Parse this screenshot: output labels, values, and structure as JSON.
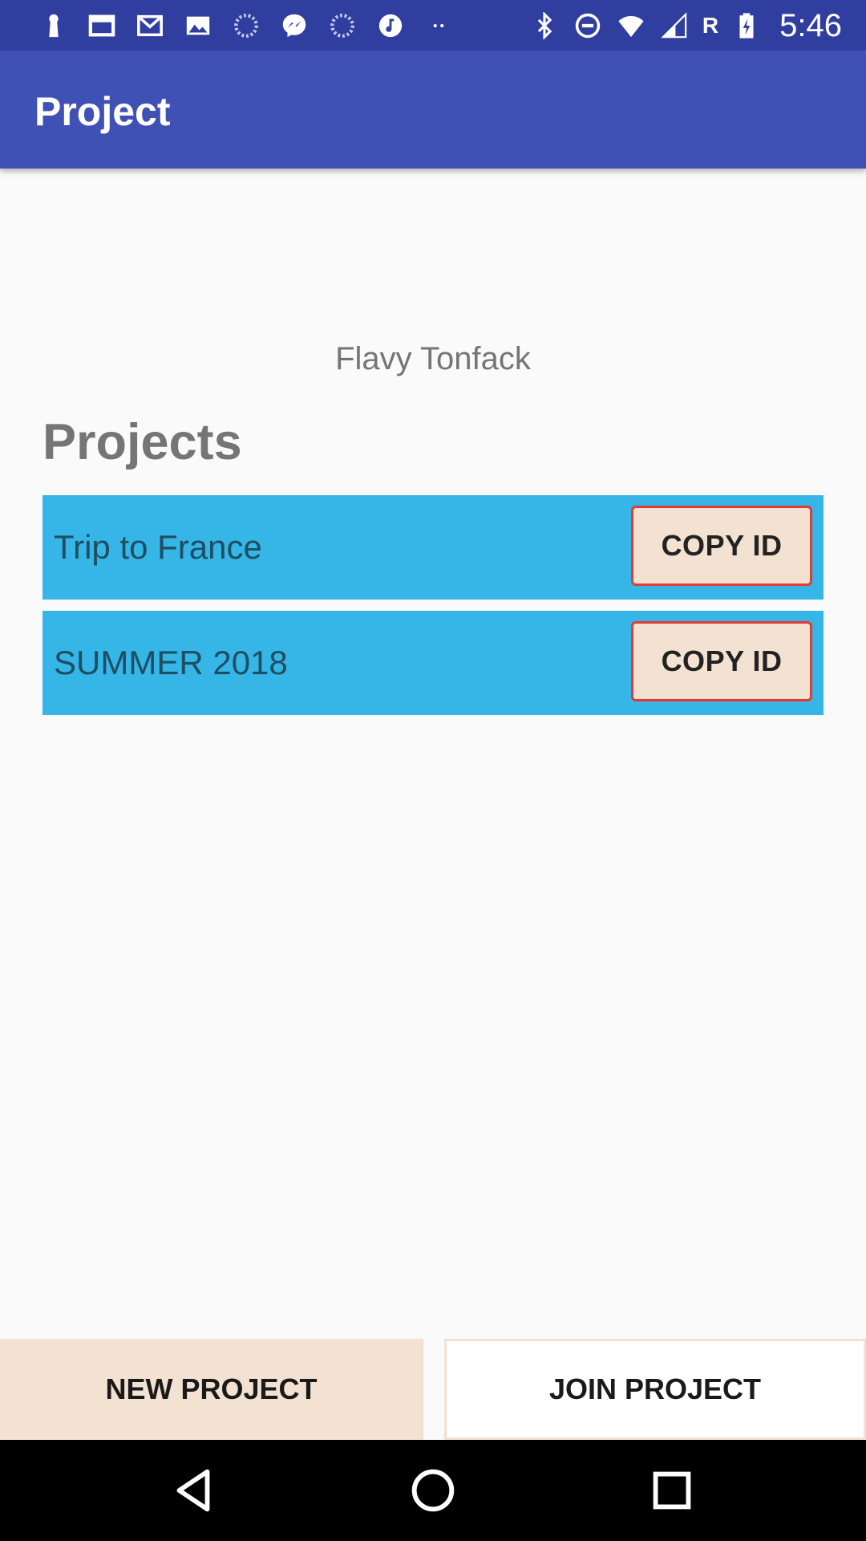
{
  "status_bar": {
    "time": "5:46",
    "carrier_indicator": "R",
    "icons_left": [
      "keyhole-icon",
      "window-icon",
      "gmail-icon",
      "image-icon",
      "loading-icon",
      "messenger-icon",
      "loading-icon",
      "music-icon",
      "more-dots-icon"
    ],
    "icons_right": [
      "bluetooth-icon",
      "do-not-disturb-icon",
      "wifi-icon",
      "signal-icon",
      "battery-charging-icon"
    ]
  },
  "app_bar": {
    "title": "Project"
  },
  "user": {
    "name": "Flavy Tonfack"
  },
  "projects": {
    "heading": "Projects",
    "items": [
      {
        "name": "Trip to France",
        "button_label": "COPY ID"
      },
      {
        "name": "SUMMER 2018",
        "button_label": "COPY ID"
      }
    ]
  },
  "actions": {
    "new_project_label": "NEW PROJECT",
    "join_project_label": "JOIN PROJECT"
  },
  "nav": {
    "icons": [
      "back-icon",
      "home-icon",
      "recents-icon"
    ]
  },
  "colors": {
    "status_bar": "#303f9f",
    "app_bar": "#3f51b5",
    "project_row": "#35b6e6",
    "button_bg": "#f3e2d1",
    "button_border": "#e53935"
  }
}
